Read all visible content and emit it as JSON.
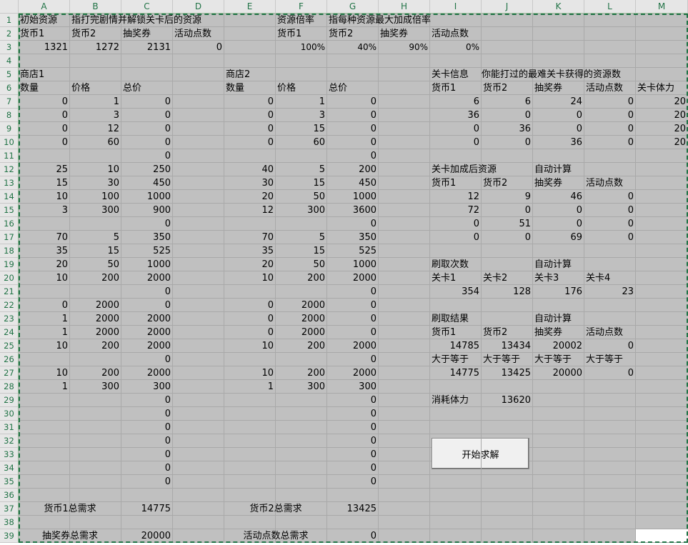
{
  "columns": [
    "A",
    "B",
    "C",
    "D",
    "E",
    "F",
    "G",
    "H",
    "I",
    "J",
    "K",
    "L",
    "M"
  ],
  "rows": [
    "1",
    "2",
    "3",
    "4",
    "5",
    "6",
    "7",
    "8",
    "9",
    "10",
    "11",
    "12",
    "13",
    "14",
    "15",
    "16",
    "17",
    "18",
    "19",
    "20",
    "21",
    "22",
    "23",
    "24",
    "25",
    "26",
    "27",
    "28",
    "29",
    "30",
    "31",
    "32",
    "33",
    "34",
    "35",
    "36",
    "37",
    "38",
    "39"
  ],
  "cells": [
    {
      "ref": "A1",
      "v": "初始资源"
    },
    {
      "ref": "B1",
      "v": "指打完剧情并解锁关卡后的资源"
    },
    {
      "ref": "F1",
      "v": "资源倍率"
    },
    {
      "ref": "G1",
      "v": "指每种资源最大加成倍率"
    },
    {
      "ref": "A2",
      "v": "货币1"
    },
    {
      "ref": "B2",
      "v": "货币2"
    },
    {
      "ref": "C2",
      "v": "抽奖券"
    },
    {
      "ref": "D2",
      "v": "活动点数"
    },
    {
      "ref": "F2",
      "v": "货币1"
    },
    {
      "ref": "G2",
      "v": "货币2"
    },
    {
      "ref": "H2",
      "v": "抽奖券"
    },
    {
      "ref": "I2",
      "v": "活动点数"
    },
    {
      "ref": "A3",
      "v": "1321",
      "num": true
    },
    {
      "ref": "B3",
      "v": "1272",
      "num": true
    },
    {
      "ref": "C3",
      "v": "2131",
      "num": true
    },
    {
      "ref": "D3",
      "v": "0",
      "num": true
    },
    {
      "ref": "F3",
      "v": "100%",
      "num": true,
      "pct": true
    },
    {
      "ref": "G3",
      "v": "40%",
      "num": true,
      "pct": true
    },
    {
      "ref": "H3",
      "v": "90%",
      "num": true,
      "pct": true
    },
    {
      "ref": "I3",
      "v": "0%",
      "num": true,
      "pct": true
    },
    {
      "ref": "A5",
      "v": "商店1"
    },
    {
      "ref": "E5",
      "v": "商店2"
    },
    {
      "ref": "I5",
      "v": "关卡信息"
    },
    {
      "ref": "J5",
      "v": "你能打过的最难关卡获得的资源数",
      "clip": true
    },
    {
      "ref": "A6",
      "v": "数量"
    },
    {
      "ref": "B6",
      "v": "价格"
    },
    {
      "ref": "C6",
      "v": "总价"
    },
    {
      "ref": "E6",
      "v": "数量"
    },
    {
      "ref": "F6",
      "v": "价格"
    },
    {
      "ref": "G6",
      "v": "总价"
    },
    {
      "ref": "I6",
      "v": "货币1"
    },
    {
      "ref": "J6",
      "v": "货币2"
    },
    {
      "ref": "K6",
      "v": "抽奖券"
    },
    {
      "ref": "L6",
      "v": "活动点数"
    },
    {
      "ref": "M6",
      "v": "关卡体力"
    },
    {
      "ref": "A7",
      "v": "0",
      "num": true
    },
    {
      "ref": "B7",
      "v": "1",
      "num": true
    },
    {
      "ref": "C7",
      "v": "0",
      "num": true
    },
    {
      "ref": "E7",
      "v": "0",
      "num": true
    },
    {
      "ref": "F7",
      "v": "1",
      "num": true
    },
    {
      "ref": "G7",
      "v": "0",
      "num": true
    },
    {
      "ref": "I7",
      "v": "6",
      "num": true
    },
    {
      "ref": "J7",
      "v": "6",
      "num": true
    },
    {
      "ref": "K7",
      "v": "24",
      "num": true
    },
    {
      "ref": "L7",
      "v": "0",
      "num": true
    },
    {
      "ref": "M7",
      "v": "20",
      "num": true
    },
    {
      "ref": "A8",
      "v": "0",
      "num": true
    },
    {
      "ref": "B8",
      "v": "3",
      "num": true
    },
    {
      "ref": "C8",
      "v": "0",
      "num": true
    },
    {
      "ref": "E8",
      "v": "0",
      "num": true
    },
    {
      "ref": "F8",
      "v": "3",
      "num": true
    },
    {
      "ref": "G8",
      "v": "0",
      "num": true
    },
    {
      "ref": "I8",
      "v": "36",
      "num": true
    },
    {
      "ref": "J8",
      "v": "0",
      "num": true
    },
    {
      "ref": "K8",
      "v": "0",
      "num": true
    },
    {
      "ref": "L8",
      "v": "0",
      "num": true
    },
    {
      "ref": "M8",
      "v": "20",
      "num": true
    },
    {
      "ref": "A9",
      "v": "0",
      "num": true
    },
    {
      "ref": "B9",
      "v": "12",
      "num": true
    },
    {
      "ref": "C9",
      "v": "0",
      "num": true
    },
    {
      "ref": "E9",
      "v": "0",
      "num": true
    },
    {
      "ref": "F9",
      "v": "15",
      "num": true
    },
    {
      "ref": "G9",
      "v": "0",
      "num": true
    },
    {
      "ref": "I9",
      "v": "0",
      "num": true
    },
    {
      "ref": "J9",
      "v": "36",
      "num": true
    },
    {
      "ref": "K9",
      "v": "0",
      "num": true
    },
    {
      "ref": "L9",
      "v": "0",
      "num": true
    },
    {
      "ref": "M9",
      "v": "20",
      "num": true
    },
    {
      "ref": "A10",
      "v": "0",
      "num": true
    },
    {
      "ref": "B10",
      "v": "60",
      "num": true
    },
    {
      "ref": "C10",
      "v": "0",
      "num": true
    },
    {
      "ref": "E10",
      "v": "0",
      "num": true
    },
    {
      "ref": "F10",
      "v": "60",
      "num": true
    },
    {
      "ref": "G10",
      "v": "0",
      "num": true
    },
    {
      "ref": "I10",
      "v": "0",
      "num": true
    },
    {
      "ref": "J10",
      "v": "0",
      "num": true
    },
    {
      "ref": "K10",
      "v": "36",
      "num": true
    },
    {
      "ref": "L10",
      "v": "0",
      "num": true
    },
    {
      "ref": "M10",
      "v": "20",
      "num": true
    },
    {
      "ref": "C11",
      "v": "0",
      "num": true
    },
    {
      "ref": "G11",
      "v": "0",
      "num": true
    },
    {
      "ref": "A12",
      "v": "25",
      "num": true
    },
    {
      "ref": "B12",
      "v": "10",
      "num": true
    },
    {
      "ref": "C12",
      "v": "250",
      "num": true
    },
    {
      "ref": "E12",
      "v": "40",
      "num": true
    },
    {
      "ref": "F12",
      "v": "5",
      "num": true
    },
    {
      "ref": "G12",
      "v": "200",
      "num": true
    },
    {
      "ref": "I12",
      "v": "关卡加成后资源"
    },
    {
      "ref": "K12",
      "v": "自动计算"
    },
    {
      "ref": "A13",
      "v": "15",
      "num": true
    },
    {
      "ref": "B13",
      "v": "30",
      "num": true
    },
    {
      "ref": "C13",
      "v": "450",
      "num": true
    },
    {
      "ref": "E13",
      "v": "30",
      "num": true
    },
    {
      "ref": "F13",
      "v": "15",
      "num": true
    },
    {
      "ref": "G13",
      "v": "450",
      "num": true
    },
    {
      "ref": "I13",
      "v": "货币1"
    },
    {
      "ref": "J13",
      "v": "货币2"
    },
    {
      "ref": "K13",
      "v": "抽奖券"
    },
    {
      "ref": "L13",
      "v": "活动点数"
    },
    {
      "ref": "A14",
      "v": "10",
      "num": true
    },
    {
      "ref": "B14",
      "v": "100",
      "num": true
    },
    {
      "ref": "C14",
      "v": "1000",
      "num": true
    },
    {
      "ref": "E14",
      "v": "20",
      "num": true
    },
    {
      "ref": "F14",
      "v": "50",
      "num": true
    },
    {
      "ref": "G14",
      "v": "1000",
      "num": true
    },
    {
      "ref": "I14",
      "v": "12",
      "num": true
    },
    {
      "ref": "J14",
      "v": "9",
      "num": true
    },
    {
      "ref": "K14",
      "v": "46",
      "num": true
    },
    {
      "ref": "L14",
      "v": "0",
      "num": true
    },
    {
      "ref": "A15",
      "v": "3",
      "num": true
    },
    {
      "ref": "B15",
      "v": "300",
      "num": true
    },
    {
      "ref": "C15",
      "v": "900",
      "num": true
    },
    {
      "ref": "E15",
      "v": "12",
      "num": true
    },
    {
      "ref": "F15",
      "v": "300",
      "num": true
    },
    {
      "ref": "G15",
      "v": "3600",
      "num": true
    },
    {
      "ref": "I15",
      "v": "72",
      "num": true
    },
    {
      "ref": "J15",
      "v": "0",
      "num": true
    },
    {
      "ref": "K15",
      "v": "0",
      "num": true
    },
    {
      "ref": "L15",
      "v": "0",
      "num": true
    },
    {
      "ref": "C16",
      "v": "0",
      "num": true
    },
    {
      "ref": "G16",
      "v": "0",
      "num": true
    },
    {
      "ref": "I16",
      "v": "0",
      "num": true
    },
    {
      "ref": "J16",
      "v": "51",
      "num": true
    },
    {
      "ref": "K16",
      "v": "0",
      "num": true
    },
    {
      "ref": "L16",
      "v": "0",
      "num": true
    },
    {
      "ref": "A17",
      "v": "70",
      "num": true
    },
    {
      "ref": "B17",
      "v": "5",
      "num": true
    },
    {
      "ref": "C17",
      "v": "350",
      "num": true
    },
    {
      "ref": "E17",
      "v": "70",
      "num": true
    },
    {
      "ref": "F17",
      "v": "5",
      "num": true
    },
    {
      "ref": "G17",
      "v": "350",
      "num": true
    },
    {
      "ref": "I17",
      "v": "0",
      "num": true
    },
    {
      "ref": "J17",
      "v": "0",
      "num": true
    },
    {
      "ref": "K17",
      "v": "69",
      "num": true
    },
    {
      "ref": "L17",
      "v": "0",
      "num": true
    },
    {
      "ref": "A18",
      "v": "35",
      "num": true
    },
    {
      "ref": "B18",
      "v": "15",
      "num": true
    },
    {
      "ref": "C18",
      "v": "525",
      "num": true
    },
    {
      "ref": "E18",
      "v": "35",
      "num": true
    },
    {
      "ref": "F18",
      "v": "15",
      "num": true
    },
    {
      "ref": "G18",
      "v": "525",
      "num": true
    },
    {
      "ref": "A19",
      "v": "20",
      "num": true
    },
    {
      "ref": "B19",
      "v": "50",
      "num": true
    },
    {
      "ref": "C19",
      "v": "1000",
      "num": true
    },
    {
      "ref": "E19",
      "v": "20",
      "num": true
    },
    {
      "ref": "F19",
      "v": "50",
      "num": true
    },
    {
      "ref": "G19",
      "v": "1000",
      "num": true
    },
    {
      "ref": "I19",
      "v": "刷取次数"
    },
    {
      "ref": "K19",
      "v": "自动计算"
    },
    {
      "ref": "A20",
      "v": "10",
      "num": true
    },
    {
      "ref": "B20",
      "v": "200",
      "num": true
    },
    {
      "ref": "C20",
      "v": "2000",
      "num": true
    },
    {
      "ref": "E20",
      "v": "10",
      "num": true
    },
    {
      "ref": "F20",
      "v": "200",
      "num": true
    },
    {
      "ref": "G20",
      "v": "2000",
      "num": true
    },
    {
      "ref": "I20",
      "v": "关卡1"
    },
    {
      "ref": "J20",
      "v": "关卡2"
    },
    {
      "ref": "K20",
      "v": "关卡3"
    },
    {
      "ref": "L20",
      "v": "关卡4"
    },
    {
      "ref": "C21",
      "v": "0",
      "num": true
    },
    {
      "ref": "G21",
      "v": "0",
      "num": true
    },
    {
      "ref": "I21",
      "v": "354",
      "num": true
    },
    {
      "ref": "J21",
      "v": "128",
      "num": true
    },
    {
      "ref": "K21",
      "v": "176",
      "num": true
    },
    {
      "ref": "L21",
      "v": "23",
      "num": true
    },
    {
      "ref": "A22",
      "v": "0",
      "num": true
    },
    {
      "ref": "B22",
      "v": "2000",
      "num": true
    },
    {
      "ref": "C22",
      "v": "0",
      "num": true
    },
    {
      "ref": "E22",
      "v": "0",
      "num": true
    },
    {
      "ref": "F22",
      "v": "2000",
      "num": true
    },
    {
      "ref": "G22",
      "v": "0",
      "num": true
    },
    {
      "ref": "A23",
      "v": "1",
      "num": true
    },
    {
      "ref": "B23",
      "v": "2000",
      "num": true
    },
    {
      "ref": "C23",
      "v": "2000",
      "num": true
    },
    {
      "ref": "E23",
      "v": "0",
      "num": true
    },
    {
      "ref": "F23",
      "v": "2000",
      "num": true
    },
    {
      "ref": "G23",
      "v": "0",
      "num": true
    },
    {
      "ref": "I23",
      "v": "刷取结果"
    },
    {
      "ref": "K23",
      "v": "自动计算"
    },
    {
      "ref": "A24",
      "v": "1",
      "num": true
    },
    {
      "ref": "B24",
      "v": "2000",
      "num": true
    },
    {
      "ref": "C24",
      "v": "2000",
      "num": true
    },
    {
      "ref": "E24",
      "v": "0",
      "num": true
    },
    {
      "ref": "F24",
      "v": "2000",
      "num": true
    },
    {
      "ref": "G24",
      "v": "0",
      "num": true
    },
    {
      "ref": "I24",
      "v": "货币1"
    },
    {
      "ref": "J24",
      "v": "货币2"
    },
    {
      "ref": "K24",
      "v": "抽奖券"
    },
    {
      "ref": "L24",
      "v": "活动点数"
    },
    {
      "ref": "A25",
      "v": "10",
      "num": true
    },
    {
      "ref": "B25",
      "v": "200",
      "num": true
    },
    {
      "ref": "C25",
      "v": "2000",
      "num": true
    },
    {
      "ref": "E25",
      "v": "10",
      "num": true
    },
    {
      "ref": "F25",
      "v": "200",
      "num": true
    },
    {
      "ref": "G25",
      "v": "2000",
      "num": true
    },
    {
      "ref": "I25",
      "v": "14785",
      "num": true
    },
    {
      "ref": "J25",
      "v": "13434",
      "num": true
    },
    {
      "ref": "K25",
      "v": "20002",
      "num": true
    },
    {
      "ref": "L25",
      "v": "0",
      "num": true
    },
    {
      "ref": "C26",
      "v": "0",
      "num": true
    },
    {
      "ref": "G26",
      "v": "0",
      "num": true
    },
    {
      "ref": "I26",
      "v": "大于等于"
    },
    {
      "ref": "J26",
      "v": "大于等于"
    },
    {
      "ref": "K26",
      "v": "大于等于"
    },
    {
      "ref": "L26",
      "v": "大于等于"
    },
    {
      "ref": "A27",
      "v": "10",
      "num": true
    },
    {
      "ref": "B27",
      "v": "200",
      "num": true
    },
    {
      "ref": "C27",
      "v": "2000",
      "num": true
    },
    {
      "ref": "E27",
      "v": "10",
      "num": true
    },
    {
      "ref": "F27",
      "v": "200",
      "num": true
    },
    {
      "ref": "G27",
      "v": "2000",
      "num": true
    },
    {
      "ref": "I27",
      "v": "14775",
      "num": true
    },
    {
      "ref": "J27",
      "v": "13425",
      "num": true
    },
    {
      "ref": "K27",
      "v": "20000",
      "num": true
    },
    {
      "ref": "L27",
      "v": "0",
      "num": true
    },
    {
      "ref": "A28",
      "v": "1",
      "num": true
    },
    {
      "ref": "B28",
      "v": "300",
      "num": true
    },
    {
      "ref": "C28",
      "v": "300",
      "num": true
    },
    {
      "ref": "E28",
      "v": "1",
      "num": true
    },
    {
      "ref": "F28",
      "v": "300",
      "num": true
    },
    {
      "ref": "G28",
      "v": "300",
      "num": true
    },
    {
      "ref": "C29",
      "v": "0",
      "num": true
    },
    {
      "ref": "G29",
      "v": "0",
      "num": true
    },
    {
      "ref": "I29",
      "v": "消耗体力"
    },
    {
      "ref": "J29",
      "v": "13620",
      "num": true
    },
    {
      "ref": "C30",
      "v": "0",
      "num": true
    },
    {
      "ref": "G30",
      "v": "0",
      "num": true
    },
    {
      "ref": "C31",
      "v": "0",
      "num": true
    },
    {
      "ref": "G31",
      "v": "0",
      "num": true
    },
    {
      "ref": "C32",
      "v": "0",
      "num": true
    },
    {
      "ref": "G32",
      "v": "0",
      "num": true
    },
    {
      "ref": "C33",
      "v": "0",
      "num": true
    },
    {
      "ref": "G33",
      "v": "0",
      "num": true
    },
    {
      "ref": "C34",
      "v": "0",
      "num": true
    },
    {
      "ref": "G34",
      "v": "0",
      "num": true
    },
    {
      "ref": "C35",
      "v": "0",
      "num": true
    },
    {
      "ref": "G35",
      "v": "0",
      "num": true
    },
    {
      "ref": "A37",
      "v": "货币1总需求",
      "ctrAB": true
    },
    {
      "ref": "C37",
      "v": "14775",
      "num": true
    },
    {
      "ref": "E37",
      "v": "货币2总需求",
      "ctrEF": true
    },
    {
      "ref": "G37",
      "v": "13425",
      "num": true
    },
    {
      "ref": "A39",
      "v": "抽奖券总需求",
      "ctrAB": true
    },
    {
      "ref": "C39",
      "v": "20000",
      "num": true
    },
    {
      "ref": "E39",
      "v": "活动点数总需求",
      "ctrEF": true
    },
    {
      "ref": "G39",
      "v": "0",
      "num": true
    }
  ],
  "solve_button": {
    "label": "开始求解"
  },
  "colors": {
    "grid_fill": "#c0c0c0",
    "header_text": "#217346",
    "selection_border": "#217346"
  }
}
